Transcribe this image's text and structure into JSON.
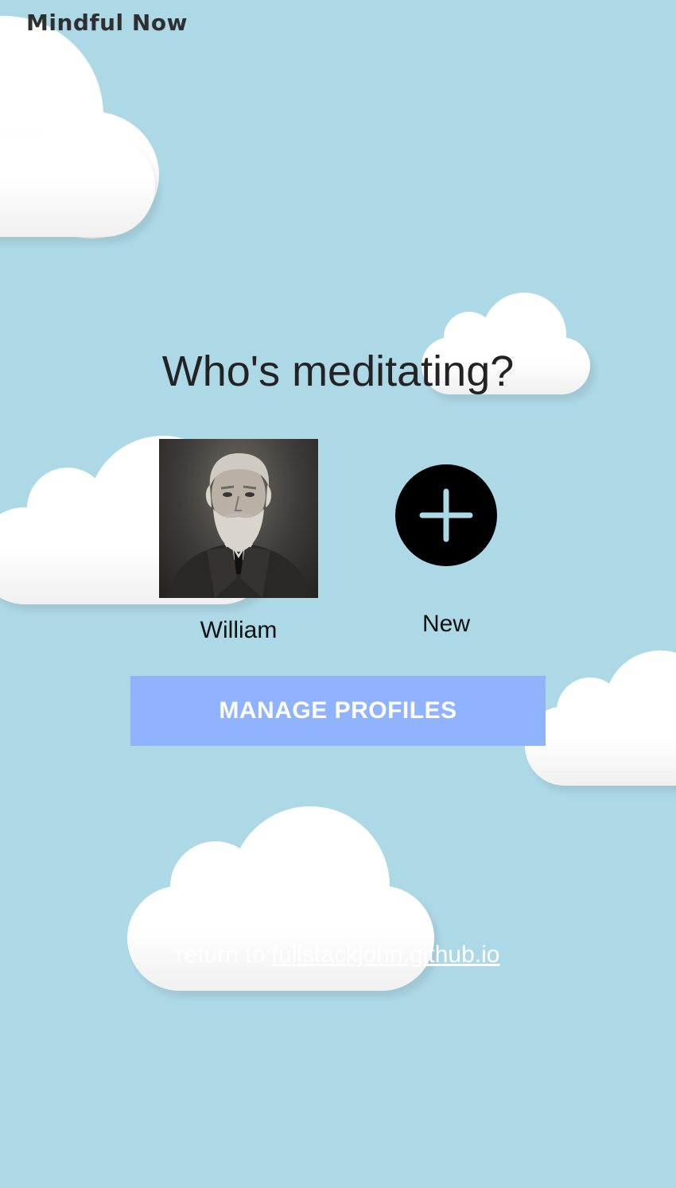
{
  "header": {
    "app_title": "Mindful Now"
  },
  "main": {
    "heading": "Who's meditating?",
    "profiles": [
      {
        "name": "William",
        "avatar": "portrait-photo"
      },
      {
        "name": "New",
        "icon": "plus-icon"
      }
    ],
    "manage_button_label": "MANAGE PROFILES"
  },
  "footer": {
    "prefix": "return to",
    "link_text": "fullstackjohn.github.io"
  },
  "colors": {
    "background": "#add8e6",
    "button": "#8fb3ff",
    "plus_icon": "#add8e6"
  }
}
